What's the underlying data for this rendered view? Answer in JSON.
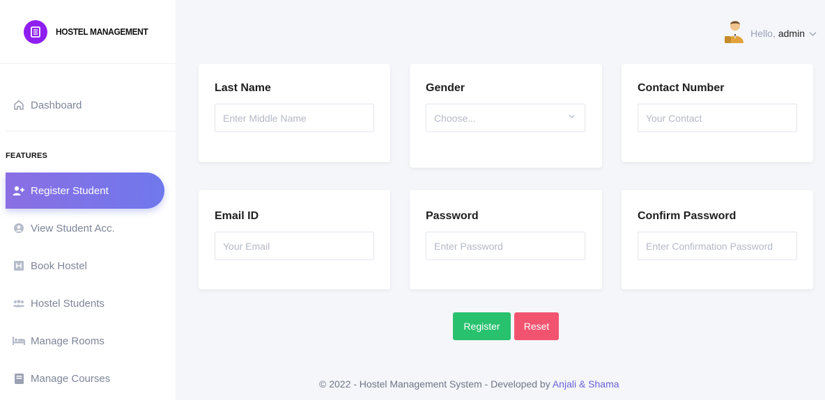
{
  "brand": {
    "name": "HOSTEL MANAGEMENT"
  },
  "header": {
    "greeting": "Hello,",
    "username": "admin"
  },
  "sidebar": {
    "items": [
      {
        "label": "Dashboard",
        "icon": "home-icon"
      },
      {
        "label": "Register Student",
        "icon": "user-plus-icon",
        "active": true
      },
      {
        "label": "View Student Acc.",
        "icon": "user-circle-icon"
      },
      {
        "label": "Book Hostel",
        "icon": "hotel-icon"
      },
      {
        "label": "Hostel Students",
        "icon": "users-icon"
      },
      {
        "label": "Manage Rooms",
        "icon": "bed-icon"
      },
      {
        "label": "Manage Courses",
        "icon": "book-icon"
      }
    ],
    "section_label": "FEATURES"
  },
  "form": {
    "last_name": {
      "label": "Last Name",
      "placeholder": "Enter Middle Name"
    },
    "gender": {
      "label": "Gender",
      "selected": "Choose..."
    },
    "contact": {
      "label": "Contact Number",
      "placeholder": "Your Contact"
    },
    "email": {
      "label": "Email ID",
      "placeholder": "Your Email"
    },
    "password": {
      "label": "Password",
      "placeholder": "Enter Password"
    },
    "confirm_password": {
      "label": "Confirm Password",
      "placeholder": "Enter Confirmation Password"
    }
  },
  "buttons": {
    "register": "Register",
    "reset": "Reset"
  },
  "footer": {
    "text": "© 2022 - Hostel Management System - Developed by",
    "developers": "Anjali & Shama"
  },
  "colors": {
    "accent": "#7b73e8",
    "register": "#28c16e",
    "reset": "#f25470",
    "brand": "#8e1ff0"
  }
}
